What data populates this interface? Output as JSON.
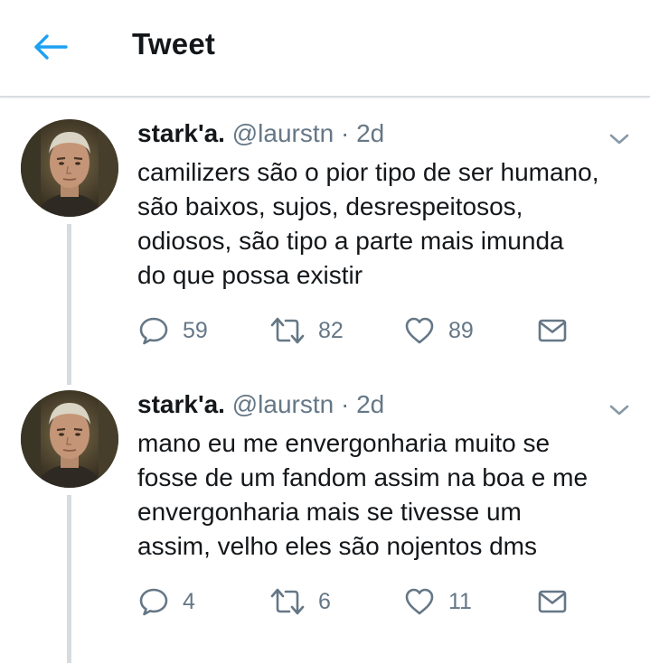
{
  "header": {
    "title": "Tweet",
    "back_icon": "arrow-left-icon",
    "accent": "#1da1f2"
  },
  "tweets": [
    {
      "name": "stark'a.",
      "handle": "@laurstn",
      "separator": "·",
      "time": "2d",
      "lines": [
        "camilizers são o pior tipo de ser humano,",
        "são baixos, sujos, desrespeitosos,",
        "odiosos, são tipo a parte mais imunda",
        "do que possa existir"
      ],
      "replies": "59",
      "retweets": "82",
      "likes": "89"
    },
    {
      "name": "stark'a.",
      "handle": "@laurstn",
      "separator": "·",
      "time": "2d",
      "lines": [
        "mano eu me envergonharia muito se",
        "fosse de um fandom assim na boa e me",
        "envergonharia mais se tivesse um",
        "assim, velho eles são nojentos dms"
      ],
      "replies": "4",
      "retweets": "6",
      "likes": "11"
    }
  ],
  "colors": {
    "text": "#14171a",
    "secondary": "#657786",
    "thread_line": "#d6dbe0"
  }
}
